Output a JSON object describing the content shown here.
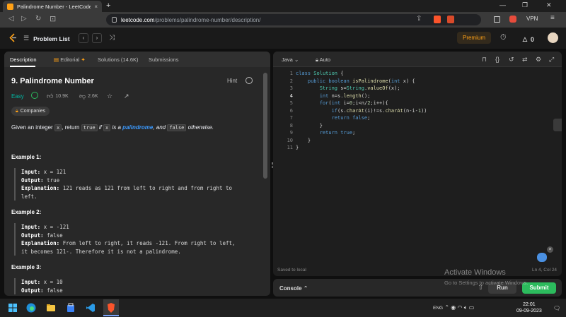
{
  "browser": {
    "tab_title": "Palindrome Number - LeetCode",
    "tab_close": "×",
    "new_tab": "+",
    "url_host": "leetcode.com",
    "url_path": "/problems/palindrome-number/description/",
    "vpn_label": "VPN"
  },
  "lcnav": {
    "problem_list": "Problem List",
    "premium": "Premium",
    "streak_count": "0"
  },
  "left_tabs": {
    "description": "Description",
    "editorial": "Editorial",
    "solutions": "Solutions (14.6K)",
    "submissions": "Submissions"
  },
  "problem": {
    "title": "9. Palindrome Number",
    "hint": "Hint",
    "difficulty": "Easy",
    "likes": "10.9K",
    "dislikes": "2.6K",
    "companies": "Companies",
    "desc_given": "Given an integer ",
    "desc_x": "x",
    "desc_return": ", return ",
    "desc_true": "true",
    "desc_if": " if ",
    "desc_x2": "x",
    "desc_is_a": " is a ",
    "desc_palindrome": "palindrome",
    "desc_and": ", and ",
    "desc_false": "false",
    "desc_otherwise": " otherwise."
  },
  "examples": [
    {
      "heading": "Example 1:",
      "input_label": "Input:",
      "input": " x = 121",
      "output_label": "Output:",
      "output": " true",
      "expl_label": "Explanation:",
      "explanation": " 121 reads as 121 from left to right and from right to",
      "explanation2": "left."
    },
    {
      "heading": "Example 2:",
      "input_label": "Input:",
      "input": " x = -121",
      "output_label": "Output:",
      "output": " false",
      "expl_label": "Explanation:",
      "explanation": " From left to right, it reads -121. From right to left,",
      "explanation2": "it becomes 121-. Therefore it is not a palindrome."
    },
    {
      "heading": "Example 3:",
      "input_label": "Input:",
      "input": " x = 10",
      "output_label": "Output:",
      "output": " false"
    }
  ],
  "editor": {
    "language": "Java",
    "auto": "Auto",
    "line_numbers": [
      "1",
      "2",
      "3",
      "4",
      "5",
      "6",
      "7",
      "8",
      "9",
      "10",
      "11"
    ],
    "saved": "Saved to local",
    "cursor": "Ln 4, Col 24"
  },
  "console": {
    "label": "Console",
    "run": "Run",
    "submit": "Submit"
  },
  "watermark": {
    "line1": "Activate Windows",
    "line2": "Go to Settings to activate Windows."
  },
  "taskbar": {
    "lang": "ENG",
    "time": "22:01",
    "date": "09-09-2023"
  },
  "colors": {
    "accent": "#ffa116",
    "easy": "#00b8a3",
    "submit": "#2cbb5d",
    "link": "#3b9aff"
  }
}
